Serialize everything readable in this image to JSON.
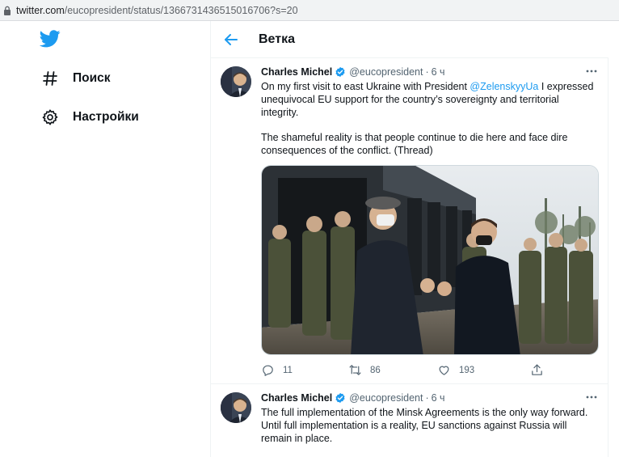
{
  "browser": {
    "url_host": "twitter.com",
    "url_path": "/eucopresident/status/1366731436515016706?s=20"
  },
  "sidebar": {
    "logo": "twitter-bird-icon",
    "items": [
      {
        "label": "Поиск",
        "icon": "hashtag-icon"
      },
      {
        "label": "Настройки",
        "icon": "gear-icon"
      }
    ]
  },
  "header": {
    "title": "Ветка"
  },
  "tweets": [
    {
      "name": "Charles Michel",
      "handle": "@eucopresident",
      "dot": "·",
      "time": "6 ч",
      "body_part1": "On my first visit to east Ukraine with President ",
      "mention": "@ZelenskyyUa",
      "body_part2": " I expressed unequivocal EU support for the country’s sovereignty and territorial integrity.",
      "body_para2": "The shameful reality is that people continue to die here and face dire consequences of the conflict. (Thread)",
      "replies": "11",
      "retweets": "86",
      "likes": "193"
    },
    {
      "name": "Charles Michel",
      "handle": "@eucopresident",
      "dot": "·",
      "time": "6 ч",
      "body": "The full implementation of the Minsk Agreements is the only way forward. Until full implementation is a reality, EU sanctions against Russia will remain in place."
    }
  ],
  "colors": {
    "accent": "#1d9bf0",
    "secondary_text": "#536471"
  }
}
